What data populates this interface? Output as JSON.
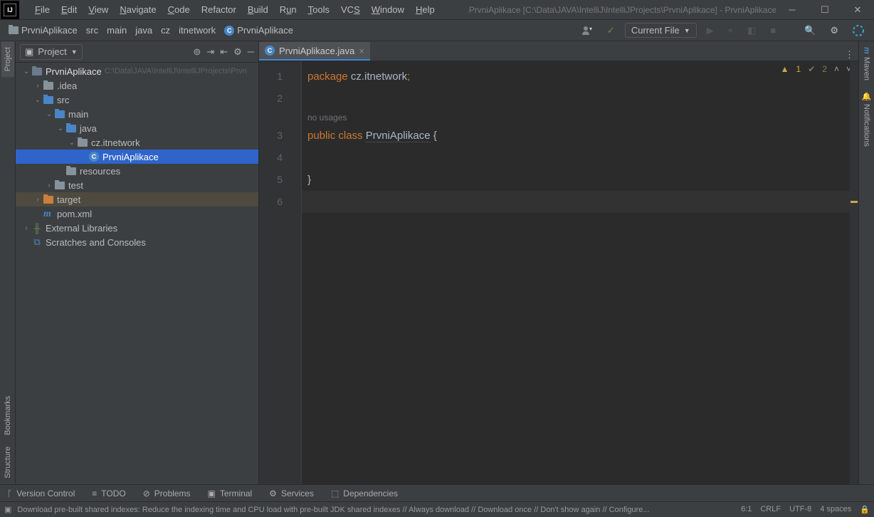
{
  "title": "PrvniAplikace [C:\\Data\\JAVA\\IntelliJ\\IntelliJProjects\\PrvniAplikace] - PrvniAplikace.java",
  "menu": [
    "File",
    "Edit",
    "View",
    "Navigate",
    "Code",
    "Refactor",
    "Build",
    "Run",
    "Tools",
    "VCS",
    "Window",
    "Help"
  ],
  "menu_accel": [
    0,
    0,
    0,
    0,
    0,
    null,
    0,
    1,
    0,
    2,
    0,
    0
  ],
  "breadcrumbs": [
    {
      "label": "PrvniAplikace",
      "icon": "folder"
    },
    {
      "label": "src"
    },
    {
      "label": "main"
    },
    {
      "label": "java"
    },
    {
      "label": "cz"
    },
    {
      "label": "itnetwork"
    },
    {
      "label": "PrvniAplikace",
      "icon": "class"
    }
  ],
  "nav_right": {
    "current_file": "Current File"
  },
  "left_tabs": {
    "project": "Project",
    "bookmarks": "Bookmarks",
    "structure": "Structure"
  },
  "right_tabs": {
    "maven": "Maven",
    "notifications": "Notifications"
  },
  "project_panel": {
    "title": "Project",
    "tree": [
      {
        "indent": 0,
        "arrow": "down",
        "icon": "folder-root",
        "bold": "PrvniAplikace",
        "hint": "C:\\Data\\JAVA\\IntelliJ\\IntelliJProjects\\Prvn"
      },
      {
        "indent": 1,
        "arrow": "right",
        "icon": "folder",
        "label": ".idea"
      },
      {
        "indent": 1,
        "arrow": "down",
        "icon": "folder-blue",
        "label": "src"
      },
      {
        "indent": 2,
        "arrow": "down",
        "icon": "folder-blue",
        "label": "main"
      },
      {
        "indent": 3,
        "arrow": "down",
        "icon": "folder-blue",
        "label": "java"
      },
      {
        "indent": 4,
        "arrow": "down",
        "icon": "folder",
        "label": "cz.itnetwork"
      },
      {
        "indent": 5,
        "arrow": "",
        "icon": "class",
        "label": "PrvniAplikace",
        "selected": true
      },
      {
        "indent": 3,
        "arrow": "",
        "icon": "folder",
        "label": "resources"
      },
      {
        "indent": 2,
        "arrow": "right",
        "icon": "folder",
        "label": "test"
      },
      {
        "indent": 1,
        "arrow": "right",
        "icon": "folder-orange",
        "label": "target",
        "highlight": true
      },
      {
        "indent": 1,
        "arrow": "",
        "icon": "maven",
        "label": "pom.xml"
      },
      {
        "indent": 0,
        "arrow": "right",
        "icon": "lib",
        "label": "External Libraries"
      },
      {
        "indent": 0,
        "arrow": "",
        "icon": "scratch",
        "label": "Scratches and Consoles"
      }
    ]
  },
  "editor": {
    "tab": "PrvniAplikace.java",
    "gutter": [
      "1",
      "2",
      "",
      "3",
      "4",
      "5",
      "6"
    ],
    "lines": [
      {
        "html": "<span class='kw'>package</span> <span class='pkg'>cz.itnetwork</span><span class='semi'>;</span>"
      },
      {
        "html": ""
      },
      {
        "html": "<span class='usages'>no usages</span>",
        "short": true
      },
      {
        "html": "<span class='kw'>public class</span> <span class='cls'>PrvniAplikace</span> <span class='pkg'>{</span>"
      },
      {
        "html": ""
      },
      {
        "html": "<span class='pkg'>}</span>"
      },
      {
        "html": "",
        "current": true
      }
    ],
    "inspect": {
      "warn": "1",
      "typo": "2"
    }
  },
  "bottom": [
    {
      "icon": "vcs",
      "label": "Version Control"
    },
    {
      "icon": "todo",
      "label": "TODO"
    },
    {
      "icon": "problems",
      "label": "Problems"
    },
    {
      "icon": "terminal",
      "label": "Terminal"
    },
    {
      "icon": "services",
      "label": "Services"
    },
    {
      "icon": "deps",
      "label": "Dependencies"
    }
  ],
  "status": {
    "msg": "Download pre-built shared indexes: Reduce the indexing time and CPU load with pre-built JDK shared indexes // Always download // Download once // Don't show again // Configure...",
    "pos": "6:1",
    "eol": "CRLF",
    "enc": "UTF-8",
    "indent": "4 spaces"
  }
}
